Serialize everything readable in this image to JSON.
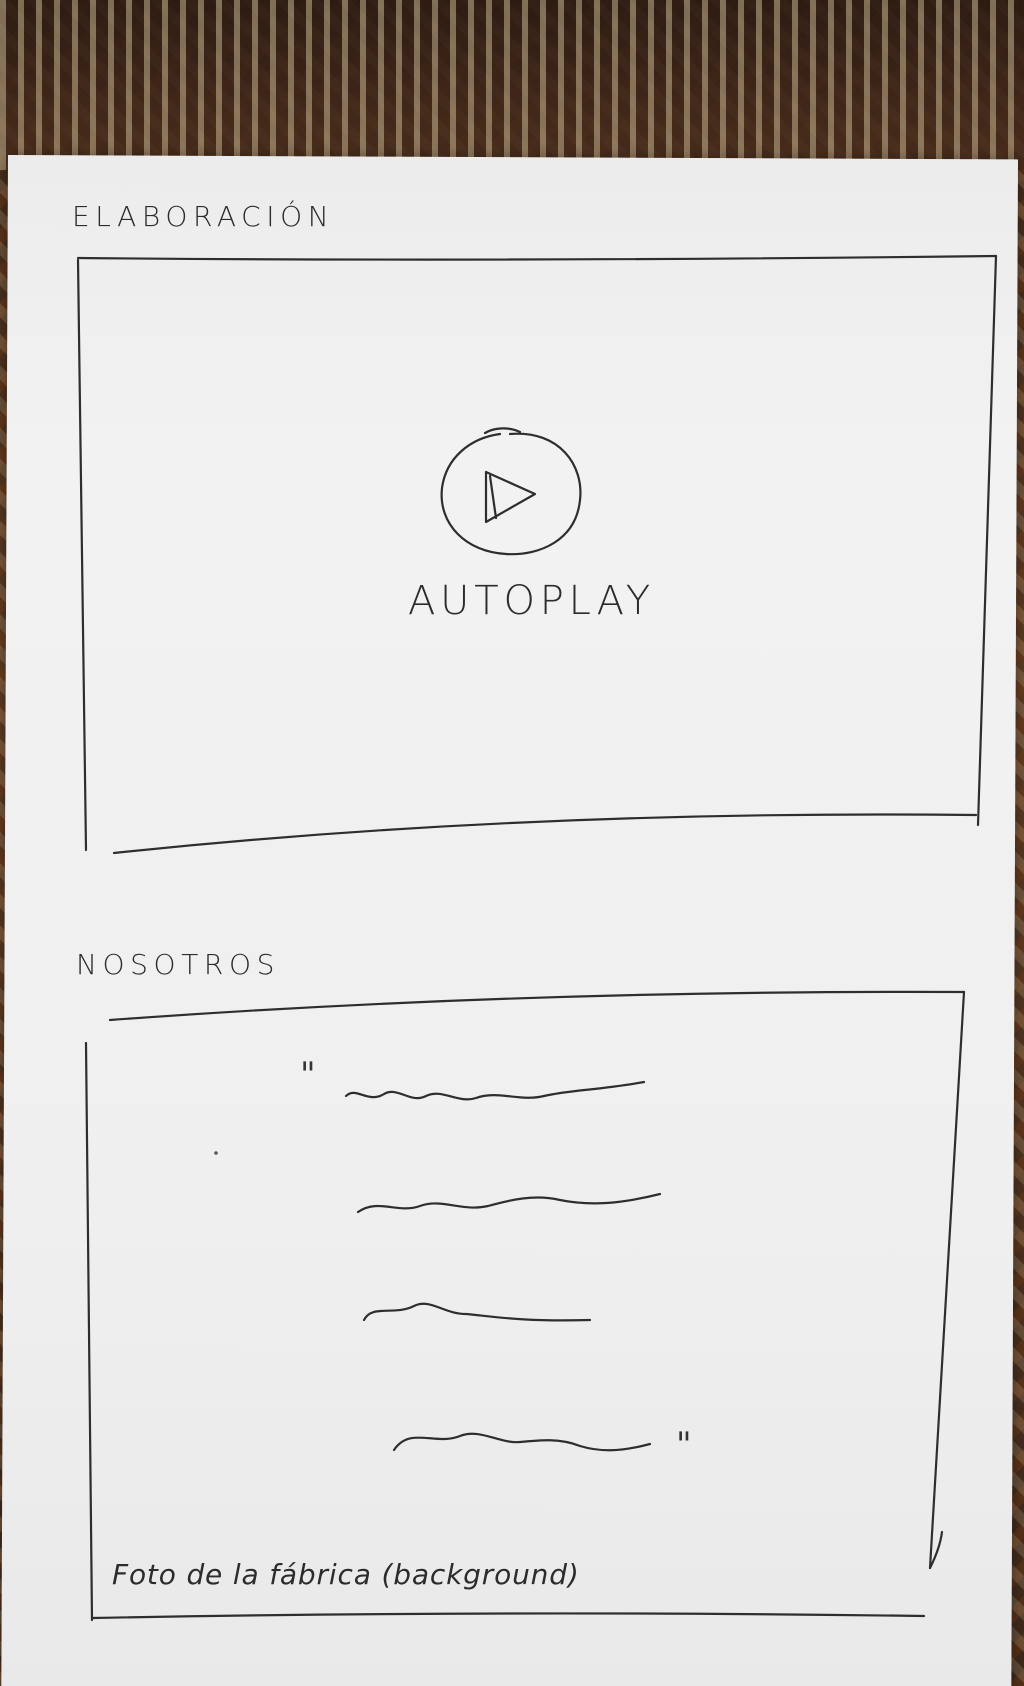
{
  "sections": {
    "elaboracion": {
      "title": "ELABORACIÓN",
      "video": {
        "play_icon": "play-circle-icon",
        "label": "AUTOPLAY"
      }
    },
    "nosotros": {
      "title": "NOSOTROS",
      "quote": {
        "open": "\"",
        "close": "\""
      },
      "background_caption": "Foto de la fábrica (background)"
    }
  },
  "colors": {
    "paper": "#efefef",
    "ink": "#2e2e2e",
    "carpet": "#4b2e1d"
  }
}
